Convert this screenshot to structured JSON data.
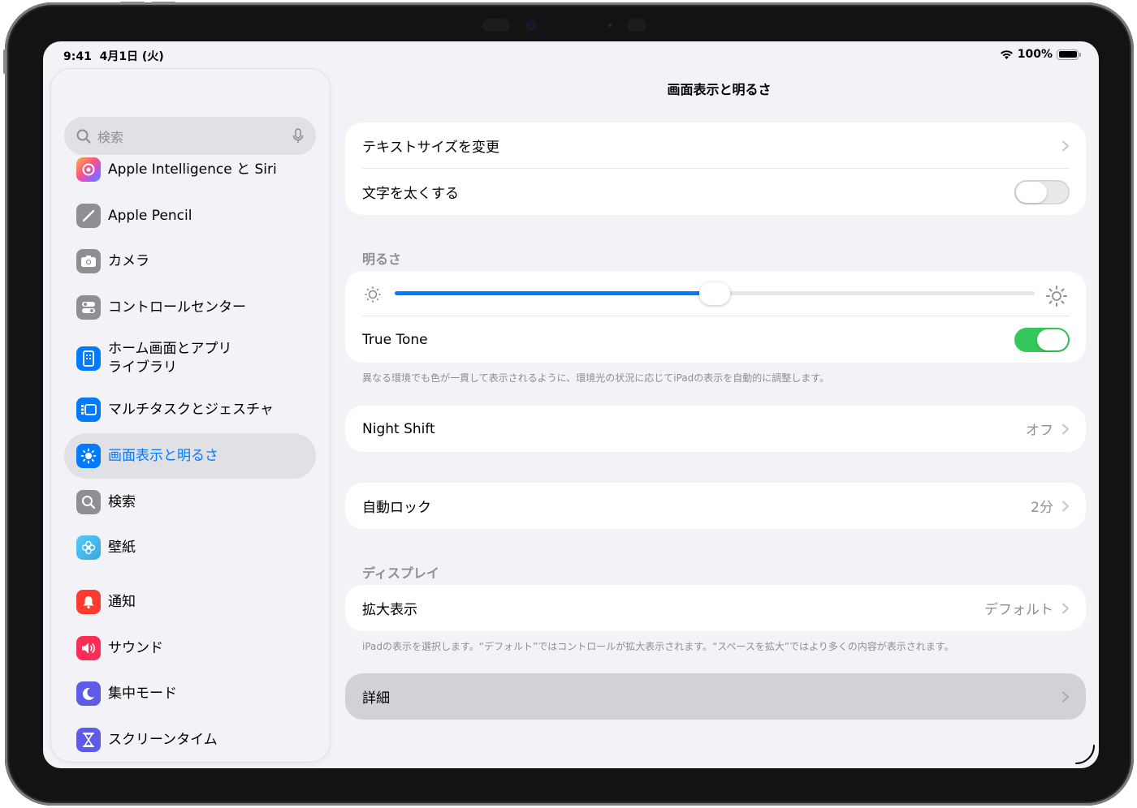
{
  "status_bar": {
    "time": "9:41",
    "date": "4月1日 (火)",
    "battery": "100%"
  },
  "sidebar": {
    "search_placeholder": "検索",
    "items": [
      {
        "label": "Apple Intelligence と Siri",
        "icon": "apple-intelligence-icon",
        "color": "#ff6b9a"
      },
      {
        "label": "Apple Pencil",
        "icon": "pencil-icon",
        "color": "#8e8e93"
      },
      {
        "label": "カメラ",
        "icon": "camera-icon",
        "color": "#8e8e93"
      },
      {
        "label": "コントロールセンター",
        "icon": "toggles-icon",
        "color": "#8e8e93"
      },
      {
        "label": "ホーム画面とアプリライブラリ",
        "line1": "ホーム画面とアプリ",
        "line2": "ライブラリ",
        "icon": "home-screen-icon",
        "color": "#007aff"
      },
      {
        "label": "マルチタスクとジェスチャ",
        "icon": "multitask-icon",
        "color": "#007aff"
      },
      {
        "label": "画面表示と明るさ",
        "icon": "sun-icon",
        "color": "#007aff",
        "active": true
      },
      {
        "label": "検索",
        "icon": "search-icon",
        "color": "#8e8e93"
      },
      {
        "label": "壁紙",
        "icon": "flower-icon",
        "color": "#34aadc"
      },
      {
        "label": "通知",
        "icon": "bell-icon",
        "color": "#ff3b30"
      },
      {
        "label": "サウンド",
        "icon": "speaker-icon",
        "color": "#ff2d55"
      },
      {
        "label": "集中モード",
        "icon": "moon-icon",
        "color": "#5e5ce6"
      },
      {
        "label": "スクリーンタイム",
        "icon": "hourglass-icon",
        "color": "#5e5ce6"
      }
    ]
  },
  "main": {
    "title": "画面表示と明るさ",
    "text_size_label": "テキストサイズを変更",
    "bold_text_label": "文字を太くする",
    "bold_text_on": false,
    "brightness_header": "明るさ",
    "brightness_level": 0.5,
    "true_tone_label": "True Tone",
    "true_tone_on": true,
    "true_tone_footnote": "異なる環境でも色が一貫して表示されるように、環境光の状況に応じてiPadの表示を自動的に調整します。",
    "night_shift_label": "Night Shift",
    "night_shift_value": "オフ",
    "auto_lock_label": "自動ロック",
    "auto_lock_value": "2分",
    "display_header": "ディスプレイ",
    "zoom_label": "拡大表示",
    "zoom_value": "デフォルト",
    "zoom_footnote": "iPadの表示を選択します。“デフォルト”ではコントロールが拡大表示されます。“スペースを拡大”ではより多くの内容が表示されます。",
    "advanced_label": "詳細"
  },
  "colors": {
    "accent": "#007aff",
    "toggle_on": "#34c759",
    "background": "#f2f2f7"
  }
}
